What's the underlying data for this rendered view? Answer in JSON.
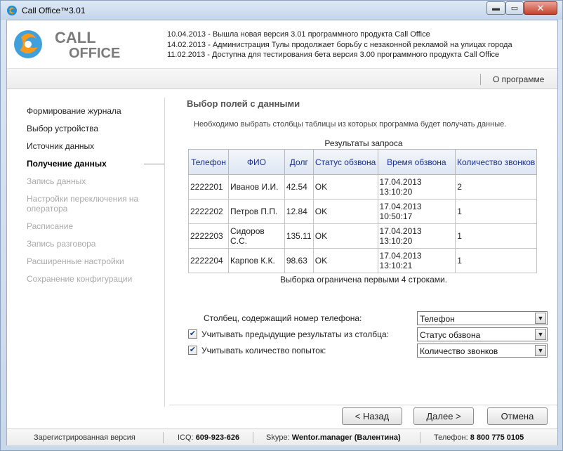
{
  "window": {
    "title": "Call Office™3.01",
    "min_label": "▬",
    "max_label": "▭",
    "close_label": "✕"
  },
  "logo": {
    "line1": "CALL",
    "line2": "OFFICE"
  },
  "news": [
    "10.04.2013 - Вышла новая версия 3.01 программного продукта Call Office",
    "14.02.2013 - Администрация Тулы продолжает борьбу с незаконной рекламой на улицах города",
    "11.02.2013 - Доступна для тестирования бета версия 3.00 программного продукта Call Office"
  ],
  "menu": {
    "about": "О программе"
  },
  "steps": [
    {
      "label": "Формирование журнала",
      "state": "normal"
    },
    {
      "label": "Выбор устройства",
      "state": "normal"
    },
    {
      "label": "Источник данных",
      "state": "normal"
    },
    {
      "label": "Получение данных",
      "state": "active"
    },
    {
      "label": "Запись данных",
      "state": "disabled"
    },
    {
      "label": "Настройки переключения на оператора",
      "state": "disabled"
    },
    {
      "label": "Расписание",
      "state": "disabled"
    },
    {
      "label": "Запись разговора",
      "state": "disabled"
    },
    {
      "label": "Расширенные настройки",
      "state": "disabled"
    },
    {
      "label": "Сохранение конфигурации",
      "state": "disabled"
    }
  ],
  "section": {
    "title": "Выбор полей с данными",
    "description": "Необходимо выбрать столбцы таблицы из которых программа будет получать данные."
  },
  "results": {
    "caption": "Результаты запроса",
    "columns": [
      "Телефон",
      "ФИО",
      "Долг",
      "Статус обзвона",
      "Время обзвона",
      "Количество звонков"
    ],
    "rows": [
      [
        "2222201",
        "Иванов И.И.",
        "42.54",
        "OK",
        "17.04.2013 13:10:20",
        "2"
      ],
      [
        "2222202",
        "Петров П.П.",
        "12.84",
        "OK",
        "17.04.2013 10:50:17",
        "1"
      ],
      [
        "2222203",
        "Сидоров С.С.",
        "135.11",
        "OK",
        "17.04.2013 13:10:20",
        "1"
      ],
      [
        "2222204",
        "Карпов К.К.",
        "98.63",
        "OK",
        "17.04.2013 13:10:21",
        "1"
      ]
    ],
    "note": "Выборка ограничена первыми 4 строками."
  },
  "form": {
    "phone_label": "Столбец, содержащий номер телефона:",
    "phone_value": "Телефон",
    "prev_label": "Учитывать предыдущие результаты из столбца:",
    "prev_checked": true,
    "prev_value": "Статус обзвона",
    "tries_label": "Учитывать количество попыток:",
    "tries_checked": true,
    "tries_value": "Количество звонков",
    "check_glyph": "✔",
    "dropdown_glyph": "▼"
  },
  "buttons": {
    "back": "< Назад",
    "next": "Далее >",
    "cancel": "Отмена"
  },
  "status": {
    "registered": "Зарегистрированная версия",
    "icq_label": "ICQ:",
    "icq_value": "609-923-626",
    "skype_label": "Skype:",
    "skype_value": "Wentor.manager (Валентина)",
    "phone_label": "Телефон:",
    "phone_value": "8 800 775 0105"
  },
  "colors": {
    "accent_blue": "#1a2f96",
    "logo_orange": "#f39a1f",
    "logo_blue": "#1f8fd6",
    "close_red": "#c7432b"
  }
}
